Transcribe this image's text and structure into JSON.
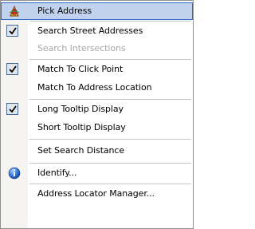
{
  "menu": {
    "items": [
      {
        "label": "Pick Address",
        "icon": "pick-address-icon",
        "checked": false,
        "disabled": false,
        "hover": true
      },
      {
        "label": "Search Street Addresses",
        "checked": true,
        "disabled": false
      },
      {
        "label": "Search Intersections",
        "checked": false,
        "disabled": true
      },
      {
        "label": "Match To Click Point",
        "checked": true,
        "disabled": false
      },
      {
        "label": "Match To Address Location",
        "checked": false,
        "disabled": false
      },
      {
        "label": "Long Tooltip Display",
        "checked": true,
        "disabled": false
      },
      {
        "label": "Short Tooltip Display",
        "checked": false,
        "disabled": false
      },
      {
        "label": "Set Search Distance",
        "checked": false,
        "disabled": false
      },
      {
        "label": "Identify...",
        "icon": "identify-icon",
        "checked": false,
        "disabled": false
      },
      {
        "label": "Address Locator Manager...",
        "checked": false,
        "disabled": false
      }
    ]
  },
  "colors": {
    "highlight": "#c1d2ee",
    "highlight_border": "#316ac5",
    "gutter": "#f5f4f0",
    "disabled_text": "#a7a6aa",
    "separator": "#c5c5c5"
  }
}
